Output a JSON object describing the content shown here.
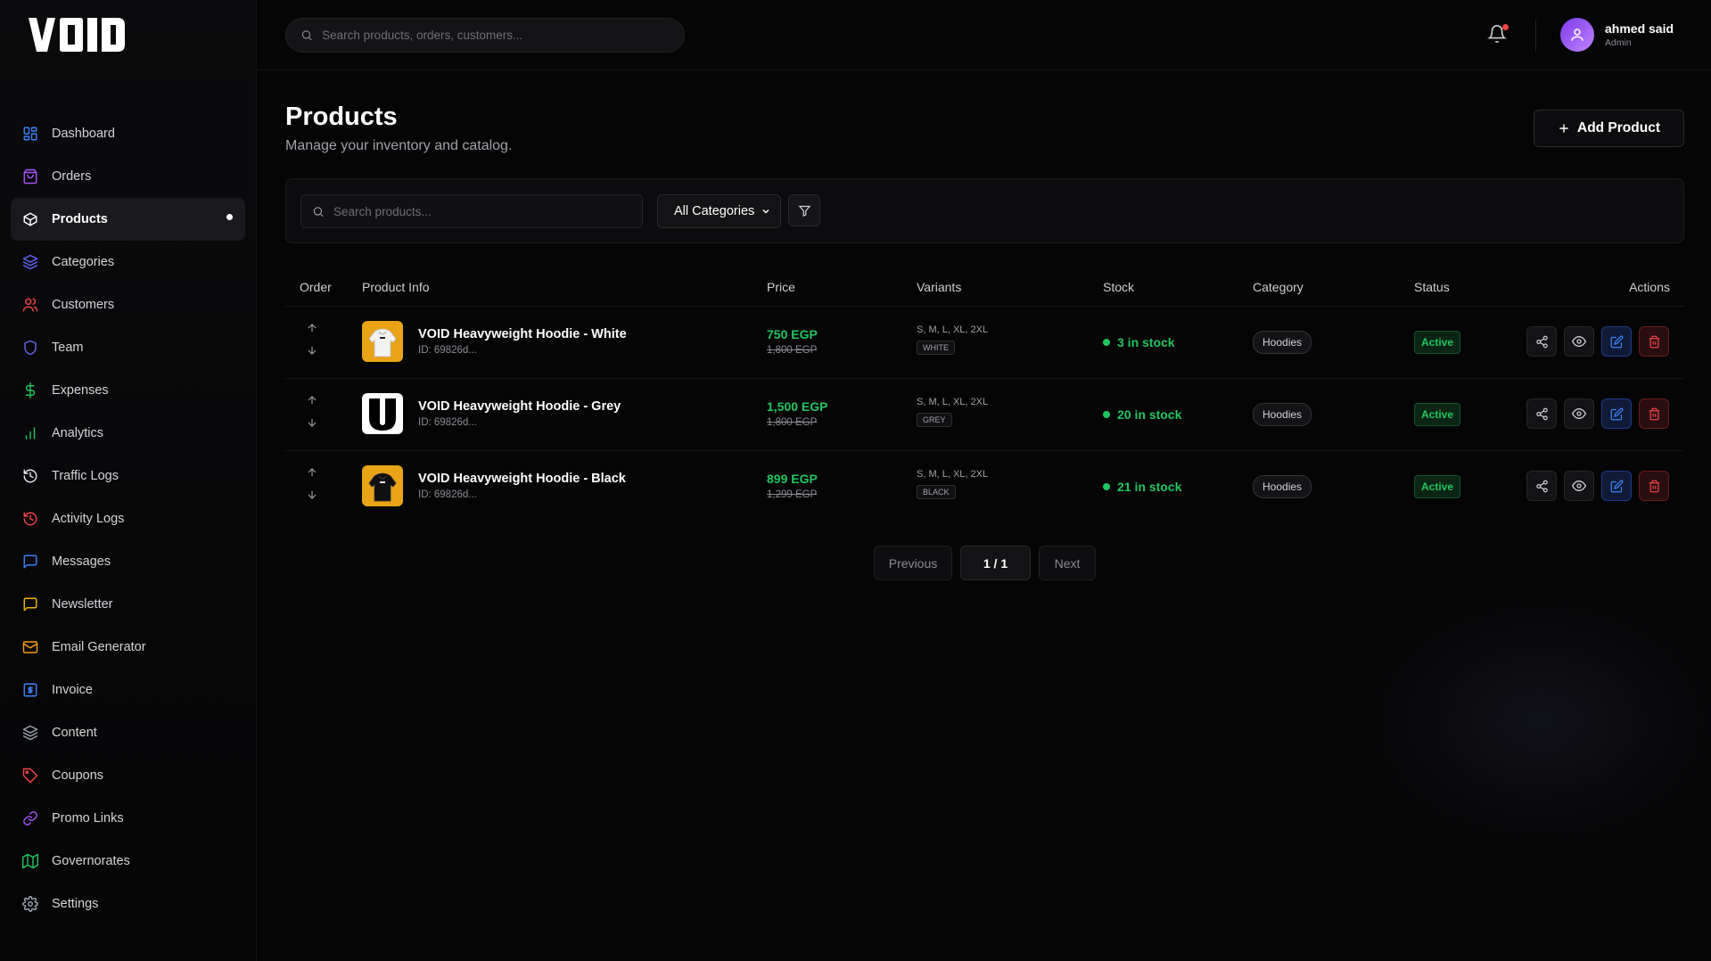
{
  "brand": {
    "logo_text": "VOID"
  },
  "sidebar": {
    "items": [
      {
        "label": "Dashboard",
        "icon": "dashboard-icon",
        "color": "#3b82f6"
      },
      {
        "label": "Orders",
        "icon": "shopping-bag-icon",
        "color": "#a855f7"
      },
      {
        "label": "Products",
        "icon": "package-icon",
        "color": "#ffffff",
        "active": true
      },
      {
        "label": "Categories",
        "icon": "layers-icon",
        "color": "#6366f1"
      },
      {
        "label": "Customers",
        "icon": "users-icon",
        "color": "#ef4444"
      },
      {
        "label": "Team",
        "icon": "shield-icon",
        "color": "#6366f1"
      },
      {
        "label": "Expenses",
        "icon": "dollar-icon",
        "color": "#22c55e"
      },
      {
        "label": "Analytics",
        "icon": "bar-chart-icon",
        "color": "#22c55e"
      },
      {
        "label": "Traffic Logs",
        "icon": "history-icon",
        "color": "#e5e7eb"
      },
      {
        "label": "Activity Logs",
        "icon": "history-icon",
        "color": "#ef4444"
      },
      {
        "label": "Messages",
        "icon": "message-square-icon",
        "color": "#3b82f6"
      },
      {
        "label": "Newsletter",
        "icon": "message-square-icon",
        "color": "#eab308"
      },
      {
        "label": "Email Generator",
        "icon": "mail-icon",
        "color": "#f59e0b"
      },
      {
        "label": "Invoice",
        "icon": "invoice-icon",
        "color": "#3b82f6"
      },
      {
        "label": "Content",
        "icon": "layers-icon",
        "color": "#9ca3af"
      },
      {
        "label": "Coupons",
        "icon": "tag-icon",
        "color": "#ef4444"
      },
      {
        "label": "Promo Links",
        "icon": "link-icon",
        "color": "#a855f7"
      },
      {
        "label": "Governorates",
        "icon": "map-icon",
        "color": "#22c55e"
      },
      {
        "label": "Settings",
        "icon": "gear-icon",
        "color": "#9ca3af"
      }
    ]
  },
  "topbar": {
    "search_placeholder": "Search products, orders, customers...",
    "user": {
      "name": "ahmed said",
      "role": "Admin"
    }
  },
  "page": {
    "title": "Products",
    "subtitle": "Manage your inventory and catalog.",
    "add_button": "Add Product"
  },
  "filters": {
    "search_placeholder": "Search products...",
    "category_selected": "All Categories"
  },
  "table": {
    "columns": [
      "Order",
      "Product Info",
      "Price",
      "Variants",
      "Stock",
      "Category",
      "Status",
      "Actions"
    ],
    "rows": [
      {
        "name": "VOID Heavyweight Hoodie - White",
        "id": "ID: 69826d...",
        "price": "750 EGP",
        "old_price": "1,800 EGP",
        "sizes": "S, M, L, XL, 2XL",
        "color": "WHITE",
        "stock": "3 in stock",
        "category": "Hoodies",
        "status": "Active",
        "thumb": "hoodie-white"
      },
      {
        "name": "VOID Heavyweight Hoodie - Grey",
        "id": "ID: 69826d...",
        "price": "1,500 EGP",
        "old_price": "1,800 EGP",
        "sizes": "S, M, L, XL, 2XL",
        "color": "GREY",
        "stock": "20 in stock",
        "category": "Hoodies",
        "status": "Active",
        "thumb": "logo-mark"
      },
      {
        "name": "VOID Heavyweight Hoodie - Black",
        "id": "ID: 69826d...",
        "price": "899 EGP",
        "old_price": "1,299 EGP",
        "sizes": "S, M, L, XL, 2XL",
        "color": "BLACK",
        "stock": "21 in stock",
        "category": "Hoodies",
        "status": "Active",
        "thumb": "hoodie-black"
      }
    ]
  },
  "pagination": {
    "prev": "Previous",
    "current": "1 / 1",
    "next": "Next"
  },
  "colors": {
    "accent_green": "#22c55e",
    "danger": "#ef4444",
    "edit_blue": "#3b82f6",
    "background": "#050506"
  }
}
